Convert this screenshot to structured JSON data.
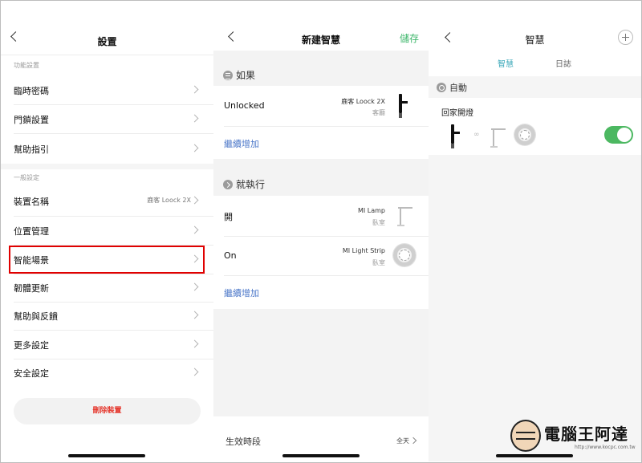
{
  "settings_panel": {
    "title": "設置",
    "section_function": "功能設置",
    "items_function": [
      {
        "label": "臨時密碼"
      },
      {
        "label": "門鎖設置"
      },
      {
        "label": "幫助指引"
      }
    ],
    "section_general": "一般設定",
    "items_general": [
      {
        "label": "裝置名稱",
        "value": "鹿客 Loock 2X"
      },
      {
        "label": "位置管理"
      },
      {
        "label": "智能場景"
      },
      {
        "label": "韌體更新"
      },
      {
        "label": "幫助與反饋"
      },
      {
        "label": "更多設定"
      },
      {
        "label": "安全設定"
      }
    ],
    "delete_label": "刪除裝置"
  },
  "new_scene_panel": {
    "title": "新建智慧",
    "save_label": "儲存",
    "if_label": "如果",
    "condition": {
      "state": "Unlocked",
      "device": "鹿客 Loock 2X",
      "room": "客廳"
    },
    "add_more": "繼續增加",
    "then_label": "就執行",
    "actions": [
      {
        "state": "開",
        "device": "MI Lamp",
        "room": "臥室"
      },
      {
        "state": "On",
        "device": "MI Light Strip",
        "room": "臥室"
      }
    ],
    "add_more_2": "繼續增加",
    "effective_label": "生效時段",
    "effective_value": "全天"
  },
  "smart_panel": {
    "title": "智慧",
    "tabs": [
      {
        "label": "智慧"
      },
      {
        "label": "日誌"
      }
    ],
    "auto_label": "自動",
    "scene_name": "回家開燈",
    "toggle_on": true,
    "link_symbol": "∞"
  },
  "watermark": {
    "text": "電腦王阿達",
    "url": "http://www.kocpc.com.tw"
  },
  "colors": {
    "save_green": "#3cb66a",
    "link_blue": "#4d78c9",
    "delete_red": "#e5382e",
    "tab_active": "#3aa7b8",
    "toggle_green": "#4cb861",
    "highlight_red": "#e00000"
  }
}
